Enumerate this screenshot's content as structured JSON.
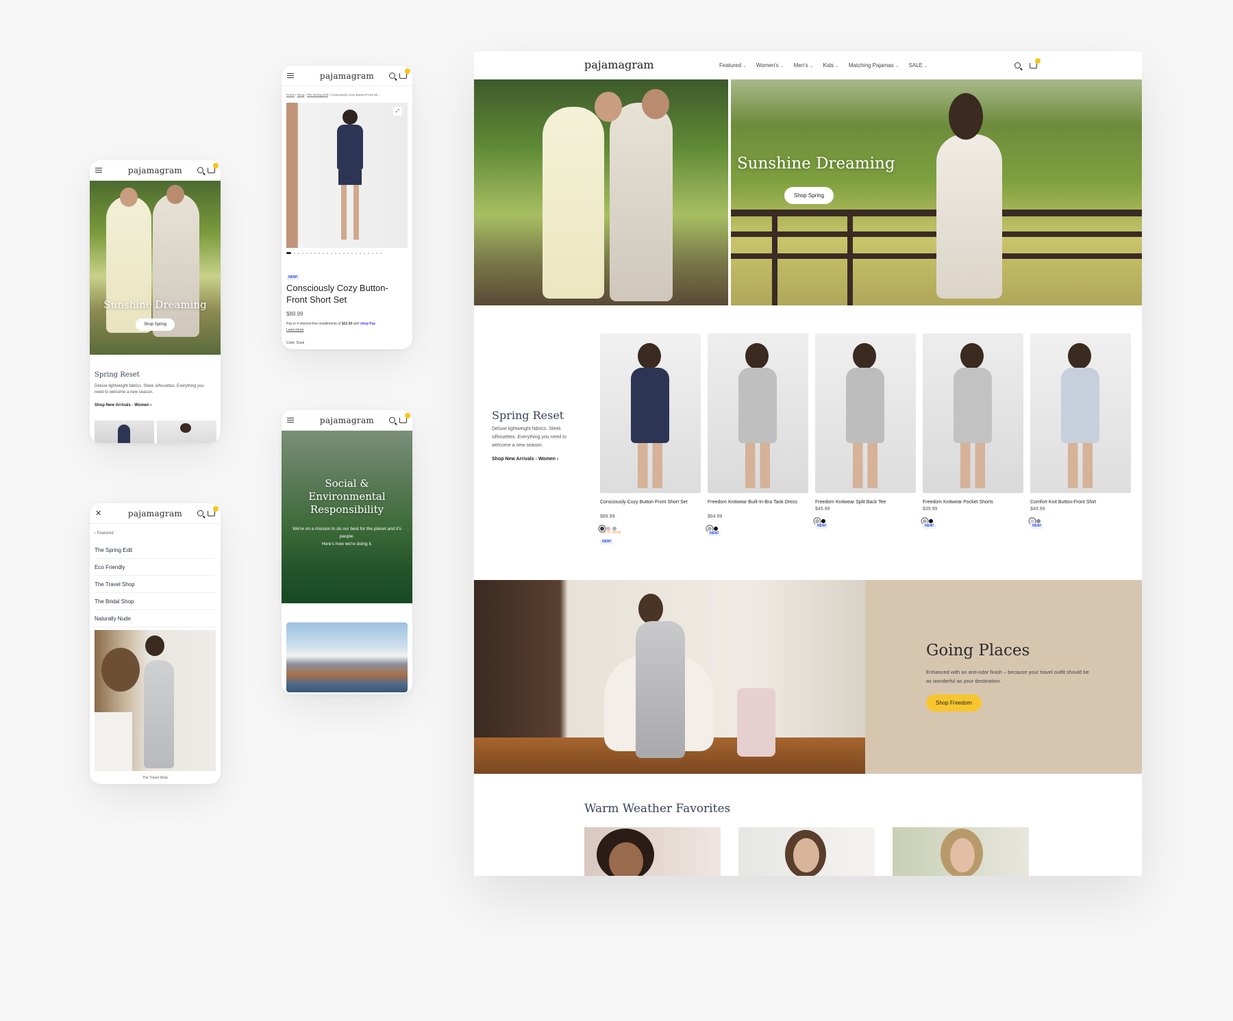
{
  "brand": "pajamagram",
  "cart_count": "0",
  "desktop": {
    "nav": [
      "Featured",
      "Women's",
      "Men's",
      "Kids",
      "Matching Pajamas",
      "SALE"
    ],
    "hero": {
      "title": "Sunshine Dreaming",
      "cta": "Shop Spring"
    },
    "spring": {
      "title": "Spring Reset",
      "desc": "Deluxe lightweight fabrics. Sleek silhouettes. Everything you need to welcome a new season.",
      "link": "Shop New Arrivals - Women ›"
    },
    "products": [
      {
        "name": "Consciously Cozy Button-Front Short Set",
        "price": "$89.99",
        "stock": "8 in stock",
        "new": "NEW!",
        "swatches": [
          "#2c3554",
          "#e8b4b8",
          "#9fb2c4"
        ]
      },
      {
        "name": "Freedom Knitwear Built-In-Bra Tank Dress",
        "price": "$64.99",
        "new": "NEW!",
        "swatches": [
          "#b0b0b0",
          "#111111"
        ]
      },
      {
        "name": "Freedom Knitwear Split Back Tee",
        "price": "$49.99",
        "new": "NEW!",
        "swatches": [
          "#b0b0b0",
          "#111111"
        ]
      },
      {
        "name": "Freedom Knitwear Pocket Shorts",
        "price": "$39.99",
        "new": "NEW!",
        "swatches": [
          "#b0b0b0",
          "#111111"
        ]
      },
      {
        "name": "Comfort Knit Button-Front Shirt",
        "price": "$49.99",
        "new": "NEW!",
        "swatches": [
          "#c8cfdc",
          "#888888"
        ]
      }
    ],
    "going": {
      "title": "Going Places",
      "desc": "Enhanced with an anti-odor finish – because your travel outfit should be as wonderful as your destination.",
      "cta": "Shop Freedom"
    },
    "warm": {
      "title": "Warm Weather Favorites"
    }
  },
  "mobile_home": {
    "hero_title": "Sunshine Dreaming",
    "cta": "Shop Spring",
    "spring_title": "Spring Reset",
    "spring_desc": "Deluxe lightweight fabrics. Sleek silhouettes. Everything you need to welcome a new season.",
    "spring_link": "Shop New Arrivals - Women ›"
  },
  "mobile_product": {
    "breadcrumb": [
      "Home",
      "Shop",
      "The Spring Edit",
      "Consciously Cozy Button-Front Sh..."
    ],
    "new": "NEW!",
    "title": "Consciously Cozy Button-Front Short Set",
    "price": "$89.99",
    "installments_prefix": "Pay in 4 interest-free installments of ",
    "installment_amount": "$22.50",
    "installments_suffix": " with ",
    "shop_pay": "shop Pay",
    "learn_more": "Learn more",
    "color": "Color: Dusk"
  },
  "mobile_mission": {
    "title": "Social & Environmental Responsibility",
    "desc": "We're on a mission to do our best for the planet and it's people.",
    "link": "Here's how we're doing it."
  },
  "mobile_menu": {
    "back": "Featured",
    "items": [
      "The Spring Edit",
      "Eco Friendly",
      "The Travel Shop",
      "The Bridal Shop",
      "Naturally Nude"
    ],
    "caption": "The Travel Shop"
  },
  "colors": {
    "accent_yellow": "#f7c62f",
    "going_bg": "#d6c6b0",
    "new_blue": "#2b4fd6",
    "stock_orange": "#e89a3c"
  }
}
